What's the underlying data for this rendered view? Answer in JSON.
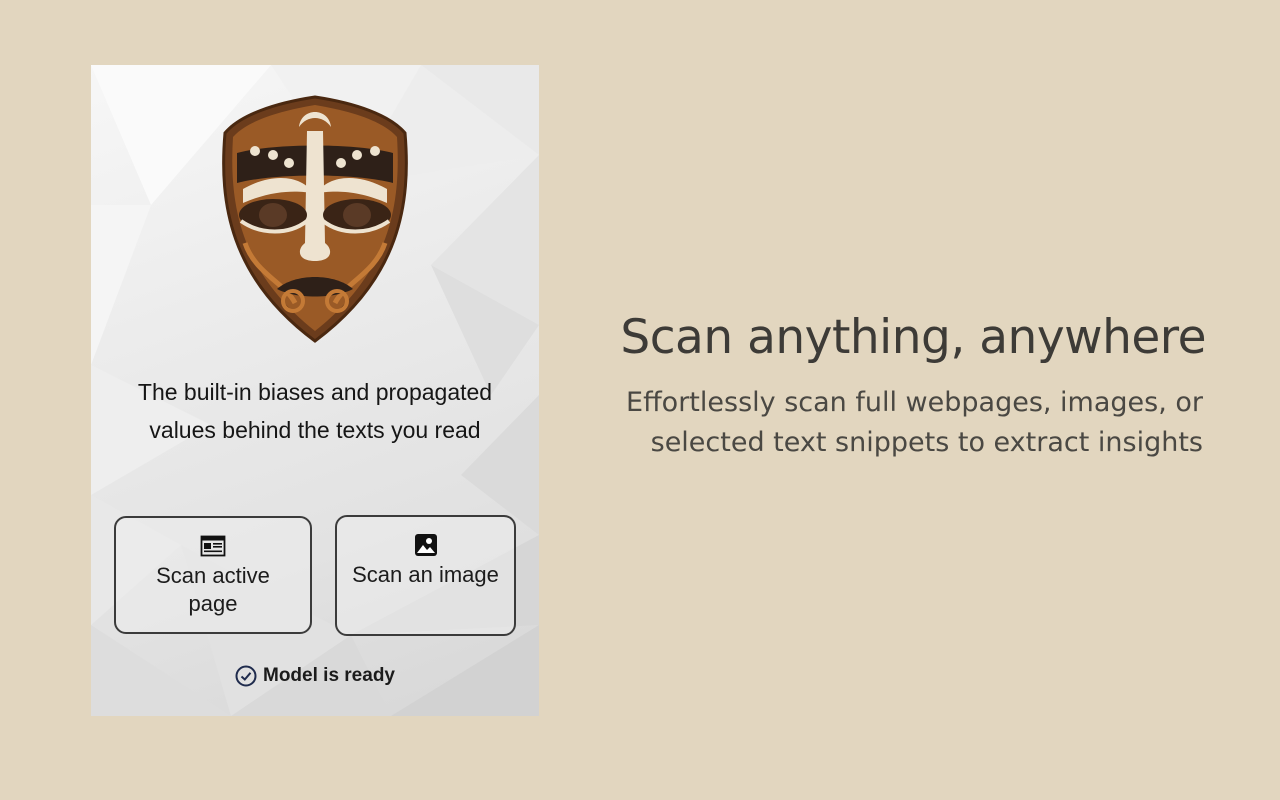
{
  "popup": {
    "tagline": "The built-in biases and propagated values behind the texts you read",
    "buttons": {
      "scan_page_label": "Scan active page",
      "scan_image_label": "Scan an image"
    },
    "status_text": "Model is ready"
  },
  "hero": {
    "title": "Scan anything, anywhere",
    "subtitle": "Effortlessly scan full webpages, images, or selected text snippets to extract insights"
  },
  "icons": {
    "logo": "tribal-mask-logo",
    "scan_page": "webpage-icon",
    "scan_image": "image-icon",
    "status": "check-circle-icon"
  },
  "colors": {
    "background": "#e2d6bf",
    "panel": "#ececec",
    "button_border": "#3b3b3b",
    "status_check": "#1f2b4d",
    "hero_text": "#3d3b37"
  }
}
